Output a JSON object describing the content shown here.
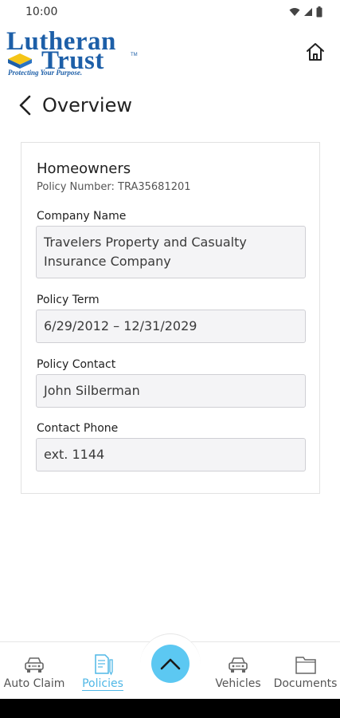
{
  "status_bar": {
    "time": "10:00",
    "icons": [
      "wifi-icon",
      "signal-icon",
      "battery-icon"
    ]
  },
  "header": {
    "logo_line1": "Lutheran",
    "logo_line2": "Trust",
    "logo_tm": "TM",
    "logo_tagline": "Protecting Your Purpose.",
    "home_icon": "home-icon"
  },
  "nav": {
    "back_icon": "chevron-left-icon",
    "title": "Overview"
  },
  "policy": {
    "type": "Homeowners",
    "number_label": "Policy Number: TRA35681201",
    "fields": [
      {
        "label": "Company Name",
        "value": "Travelers Property and Casualty Insurance Company"
      },
      {
        "label": "Policy Term",
        "value": "6/29/2012 – 12/31/2029"
      },
      {
        "label": "Policy Contact",
        "value": "John Silberman"
      },
      {
        "label": "Contact Phone",
        "value": "ext. 1144"
      }
    ]
  },
  "bottom_nav": {
    "items": [
      {
        "label": "Auto Claim",
        "icon": "car-icon",
        "active": false
      },
      {
        "label": "Policies",
        "icon": "document-pen-icon",
        "active": true
      },
      {
        "label": "Vehicles",
        "icon": "car-icon",
        "active": false
      },
      {
        "label": "Documents",
        "icon": "folder-icon",
        "active": false
      }
    ],
    "fab_icon": "chevron-up-icon"
  },
  "colors": {
    "brand_blue": "#1d5fa8",
    "accent": "#4fb7e6",
    "fab": "#5cc8f2",
    "field_bg": "#f4f4f6"
  }
}
